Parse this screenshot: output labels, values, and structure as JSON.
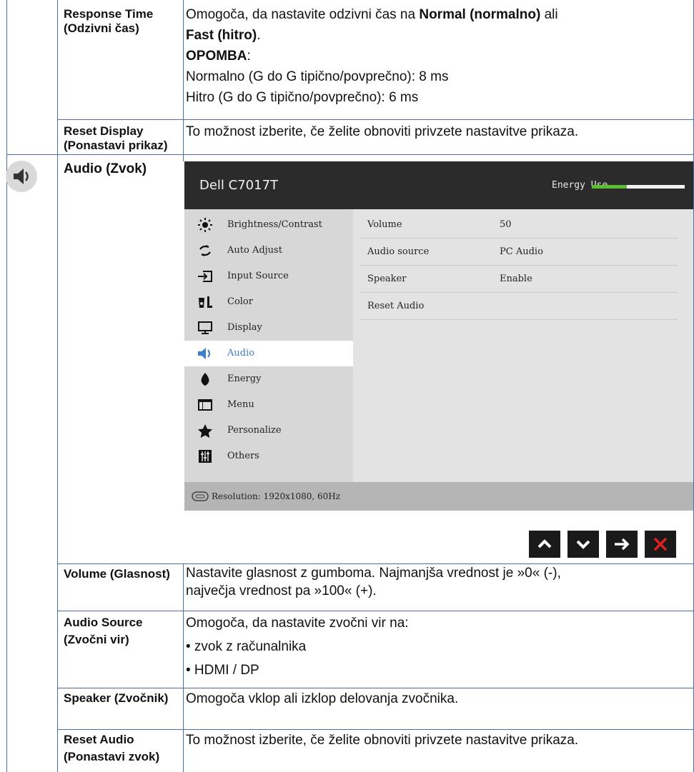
{
  "rows": {
    "response_time": {
      "label": "Response Time (Odzivni čas)",
      "line1_pre": "Omogoča, da nastavite odzivni čas na ",
      "line1_bold": "Normal (normalno)",
      "line1_post": " ali",
      "line2_bold": "Fast (hitro)",
      "line2_post": ".",
      "note_label": "OPOMBA",
      "note_colon": ":",
      "normal": "Normalno (G do G tipično/povprečno): 8 ms",
      "fast": "Hitro (G do G tipično/povprečno): 6 ms"
    },
    "reset_display": {
      "label": "Reset Display (Ponastavi prikaz)",
      "text": "To možnost izberite, če želite obnoviti privzete nastavitve prikaza."
    },
    "audio": {
      "label": "Audio (Zvok)"
    },
    "volume": {
      "label": "Volume (Glasnost)",
      "text1": "Nastavite glasnost z gumboma. Najmanjša vrednost je »0« (-),",
      "text2": "največja vrednost pa »100« (+)."
    },
    "audio_source": {
      "label": "Audio Source (Zvočni vir)",
      "text": "Omogoča, da nastavite zvočni vir na:",
      "opt1": "• zvok z računalnika",
      "opt2": "• HDMI / DP"
    },
    "speaker": {
      "label": "Speaker (Zvočnik)",
      "text": "Omogoča vklop ali izklop delovanja zvočnika."
    },
    "reset_audio": {
      "label": "Reset Audio (Ponastavi zvok)",
      "text": "To možnost izberite, če želite obnoviti privzete nastavitve prikaza."
    }
  },
  "osd": {
    "title": "Dell C7017T",
    "energy_label": "Energy Use",
    "energy_level": 0.38,
    "energy_color": "#5cbd32",
    "accent_color": "#3f7ec9",
    "menu": [
      {
        "label": "Brightness/Contrast",
        "icon": "brightness-icon"
      },
      {
        "label": "Auto Adjust",
        "icon": "auto-adjust-icon"
      },
      {
        "label": "Input Source",
        "icon": "input-source-icon"
      },
      {
        "label": "Color",
        "icon": "color-icon"
      },
      {
        "label": "Display",
        "icon": "display-icon"
      },
      {
        "label": "Audio",
        "icon": "speaker-icon"
      },
      {
        "label": "Energy",
        "icon": "energy-icon"
      },
      {
        "label": "Menu",
        "icon": "menu-icon"
      },
      {
        "label": "Personalize",
        "icon": "star-icon"
      },
      {
        "label": "Others",
        "icon": "others-icon"
      }
    ],
    "active_menu": "Audio",
    "options": [
      {
        "name": "Volume",
        "value": "50"
      },
      {
        "name": "Audio source",
        "value": "PC Audio"
      },
      {
        "name": "Speaker",
        "value": "Enable"
      },
      {
        "name": "Reset Audio",
        "value": ""
      }
    ],
    "resolution": "Resolution: 1920x1080, 60Hz",
    "nav_buttons": [
      "up-icon",
      "down-icon",
      "right-arrow-icon",
      "close-icon"
    ]
  }
}
